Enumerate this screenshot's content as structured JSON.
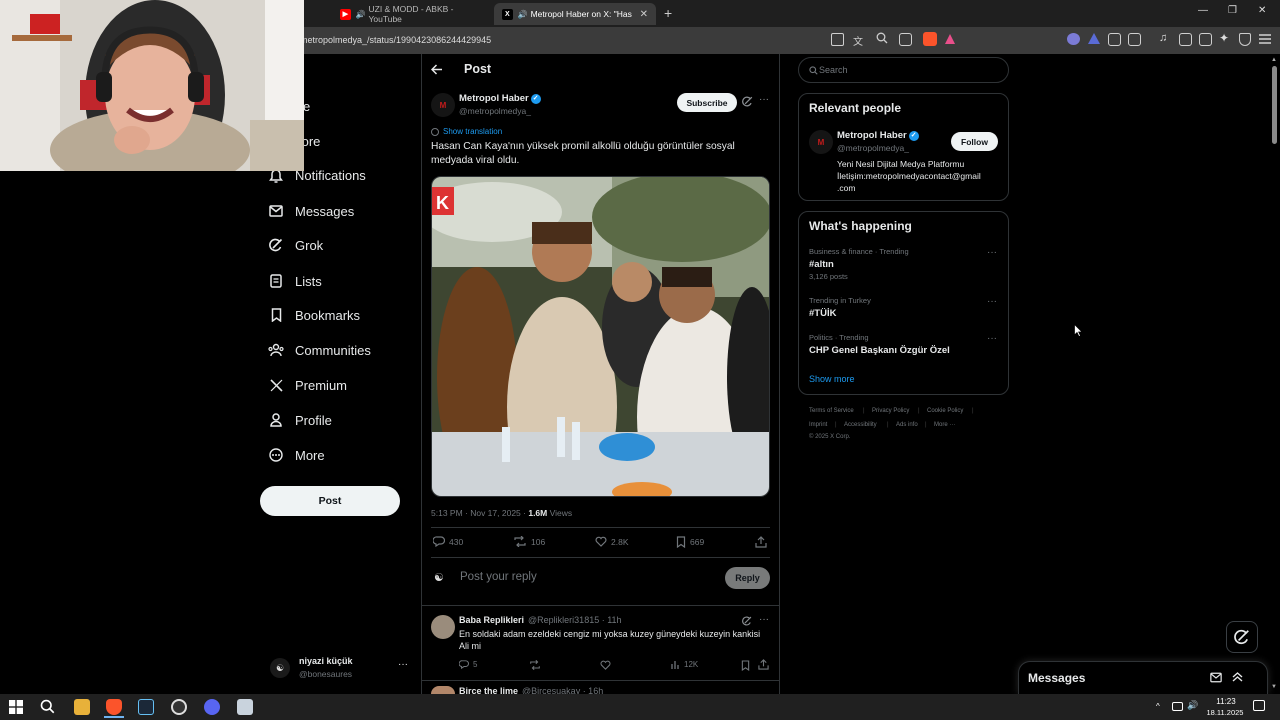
{
  "browser": {
    "tabs": [
      {
        "label": "UZI & MODD - ABKB - YouTube",
        "active": false
      },
      {
        "label": "Metropol Haber on X: \"Hasan",
        "active": true
      }
    ],
    "url": "metropolmedya_/status/1990423086244429945",
    "window_controls": [
      "—",
      "❐",
      "✕"
    ]
  },
  "nav": {
    "items": [
      {
        "label": "Home",
        "icon": "home-icon"
      },
      {
        "label": "Explore",
        "icon": "search-icon"
      },
      {
        "label": "Notifications",
        "icon": "bell-icon"
      },
      {
        "label": "Messages",
        "icon": "envelope-icon"
      },
      {
        "label": "Grok",
        "icon": "grok-icon"
      },
      {
        "label": "Lists",
        "icon": "list-icon"
      },
      {
        "label": "Bookmarks",
        "icon": "bookmark-icon"
      },
      {
        "label": "Communities",
        "icon": "people-icon"
      },
      {
        "label": "Premium",
        "icon": "x-logo-icon"
      },
      {
        "label": "Profile",
        "icon": "person-icon"
      },
      {
        "label": "More",
        "icon": "more-circle-icon"
      }
    ],
    "visible_labels": [
      "ome",
      "xplore",
      "Notifications",
      "Messages",
      "Grok",
      "Lists",
      "Bookmarks",
      "Communities",
      "Premium",
      "Profile",
      "More"
    ],
    "post_button": "Post",
    "account": {
      "name": "niyazi küçük",
      "handle": "@bonesaures"
    }
  },
  "post": {
    "header_title": "Post",
    "author_name": "Metropol Haber",
    "author_handle": "@metropolmedya_",
    "subscribe_label": "Subscribe",
    "translation_link": "Show translation",
    "text": "Hasan Can Kaya'nın yüksek promil alkollü olduğu görüntüler sosyal medyada viral oldu.",
    "timestamp": "5:13 PM · Nov 17, 2025 ·",
    "views_count": "1.6M",
    "views_label": "Views",
    "stats": {
      "replies": "430",
      "reposts": "106",
      "likes": "2.8K",
      "bookmarks": "669"
    },
    "reply_placeholder": "Post your reply",
    "reply_button": "Reply"
  },
  "replies": [
    {
      "name": "Baba Replikleri",
      "handle": "@Replikleri31815 · 11h",
      "text_line1": "En soldaki adam ezeldeki cengiz mi yoksa kuzey güneydeki kuzeyin kankisi",
      "text_line2": "Ali mi",
      "stats": {
        "replies": "5",
        "reposts": "",
        "likes": "",
        "views": "12K"
      }
    },
    {
      "name": "Birce the lime",
      "handle": "@Bircesuakay · 16h"
    }
  ],
  "search": {
    "placeholder": "Search"
  },
  "relevant_people": {
    "title": "Relevant people",
    "name": "Metropol Haber",
    "handle": "@metropolmedya_",
    "follow_label": "Follow",
    "bio_line1": "Yeni Nesil Dijital Medya Platformu",
    "bio_line2": "İletişim:metropolmedyacontact@gmail",
    "bio_line3": ".com"
  },
  "whats_happening": {
    "title": "What's happening",
    "trends": [
      {
        "category": "Business & finance · Trending",
        "name": "#altın",
        "count": "3,126 posts"
      },
      {
        "category": "Trending in Turkey",
        "name": "#TÜİK",
        "count": ""
      },
      {
        "category": "Politics · Trending",
        "name": "CHP Genel Başkanı Özgür Özel",
        "count": ""
      }
    ],
    "show_more": "Show more"
  },
  "footer": {
    "links_row1": [
      "Terms of Service",
      "Privacy Policy",
      "Cookie Policy"
    ],
    "links_row2": [
      "Imprint",
      "Accessibility",
      "Ads info",
      "More ···"
    ],
    "copyright": "© 2025 X Corp."
  },
  "messages_dock": {
    "title": "Messages"
  },
  "taskbar": {
    "time": "11:23",
    "date": "18.11.2025"
  },
  "colors": {
    "background": "#000000",
    "accent": "#1d9bf0",
    "text": "#e7e9ea",
    "muted": "#71767b",
    "border": "#2f3336"
  }
}
